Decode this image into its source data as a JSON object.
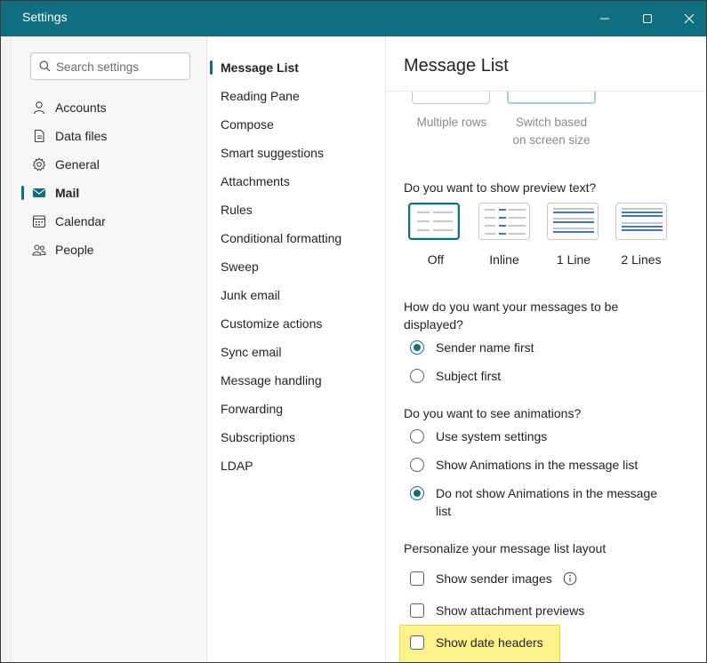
{
  "window": {
    "title": "Settings",
    "accent": "#0f6f80"
  },
  "search": {
    "placeholder": "Search settings"
  },
  "sidebar": {
    "items": [
      {
        "label": "Accounts",
        "icon": "person-icon"
      },
      {
        "label": "Data files",
        "icon": "document-icon"
      },
      {
        "label": "General",
        "icon": "gear-icon"
      },
      {
        "label": "Mail",
        "icon": "mail-icon",
        "active": true
      },
      {
        "label": "Calendar",
        "icon": "calendar-icon"
      },
      {
        "label": "People",
        "icon": "people-icon"
      }
    ]
  },
  "subnav": {
    "items": [
      {
        "label": "Message List",
        "active": true
      },
      {
        "label": "Reading Pane"
      },
      {
        "label": "Compose"
      },
      {
        "label": "Smart suggestions"
      },
      {
        "label": "Attachments"
      },
      {
        "label": "Rules"
      },
      {
        "label": "Conditional formatting"
      },
      {
        "label": "Sweep"
      },
      {
        "label": "Junk email"
      },
      {
        "label": "Customize actions"
      },
      {
        "label": "Sync email"
      },
      {
        "label": "Message handling"
      },
      {
        "label": "Forwarding"
      },
      {
        "label": "Subscriptions"
      },
      {
        "label": "LDAP"
      }
    ]
  },
  "content": {
    "title": "Message List",
    "layout_options": {
      "multiple_rows": "Multiple rows",
      "switch_line1": "Switch based",
      "switch_line2": "on screen size"
    },
    "preview": {
      "question": "Do you want to show preview text?",
      "options": [
        "Off",
        "Inline",
        "1 Line",
        "2 Lines"
      ],
      "selected": "Off"
    },
    "display": {
      "question_line1": "How do you want your messages to be",
      "question_line2": "displayed?",
      "options": [
        "Sender name first",
        "Subject first"
      ],
      "selected": "Sender name first"
    },
    "animations": {
      "question": "Do you want to see animations?",
      "options": [
        "Use system settings",
        "Show Animations in the message list"
      ],
      "option3_line1": "Do not show Animations in the message",
      "option3_line2": "list",
      "selected": "Do not show Animations in the message list"
    },
    "personalize": {
      "heading": "Personalize your message list layout",
      "options": [
        "Show sender images",
        "Show attachment previews",
        "Show date headers"
      ],
      "checked": []
    }
  }
}
